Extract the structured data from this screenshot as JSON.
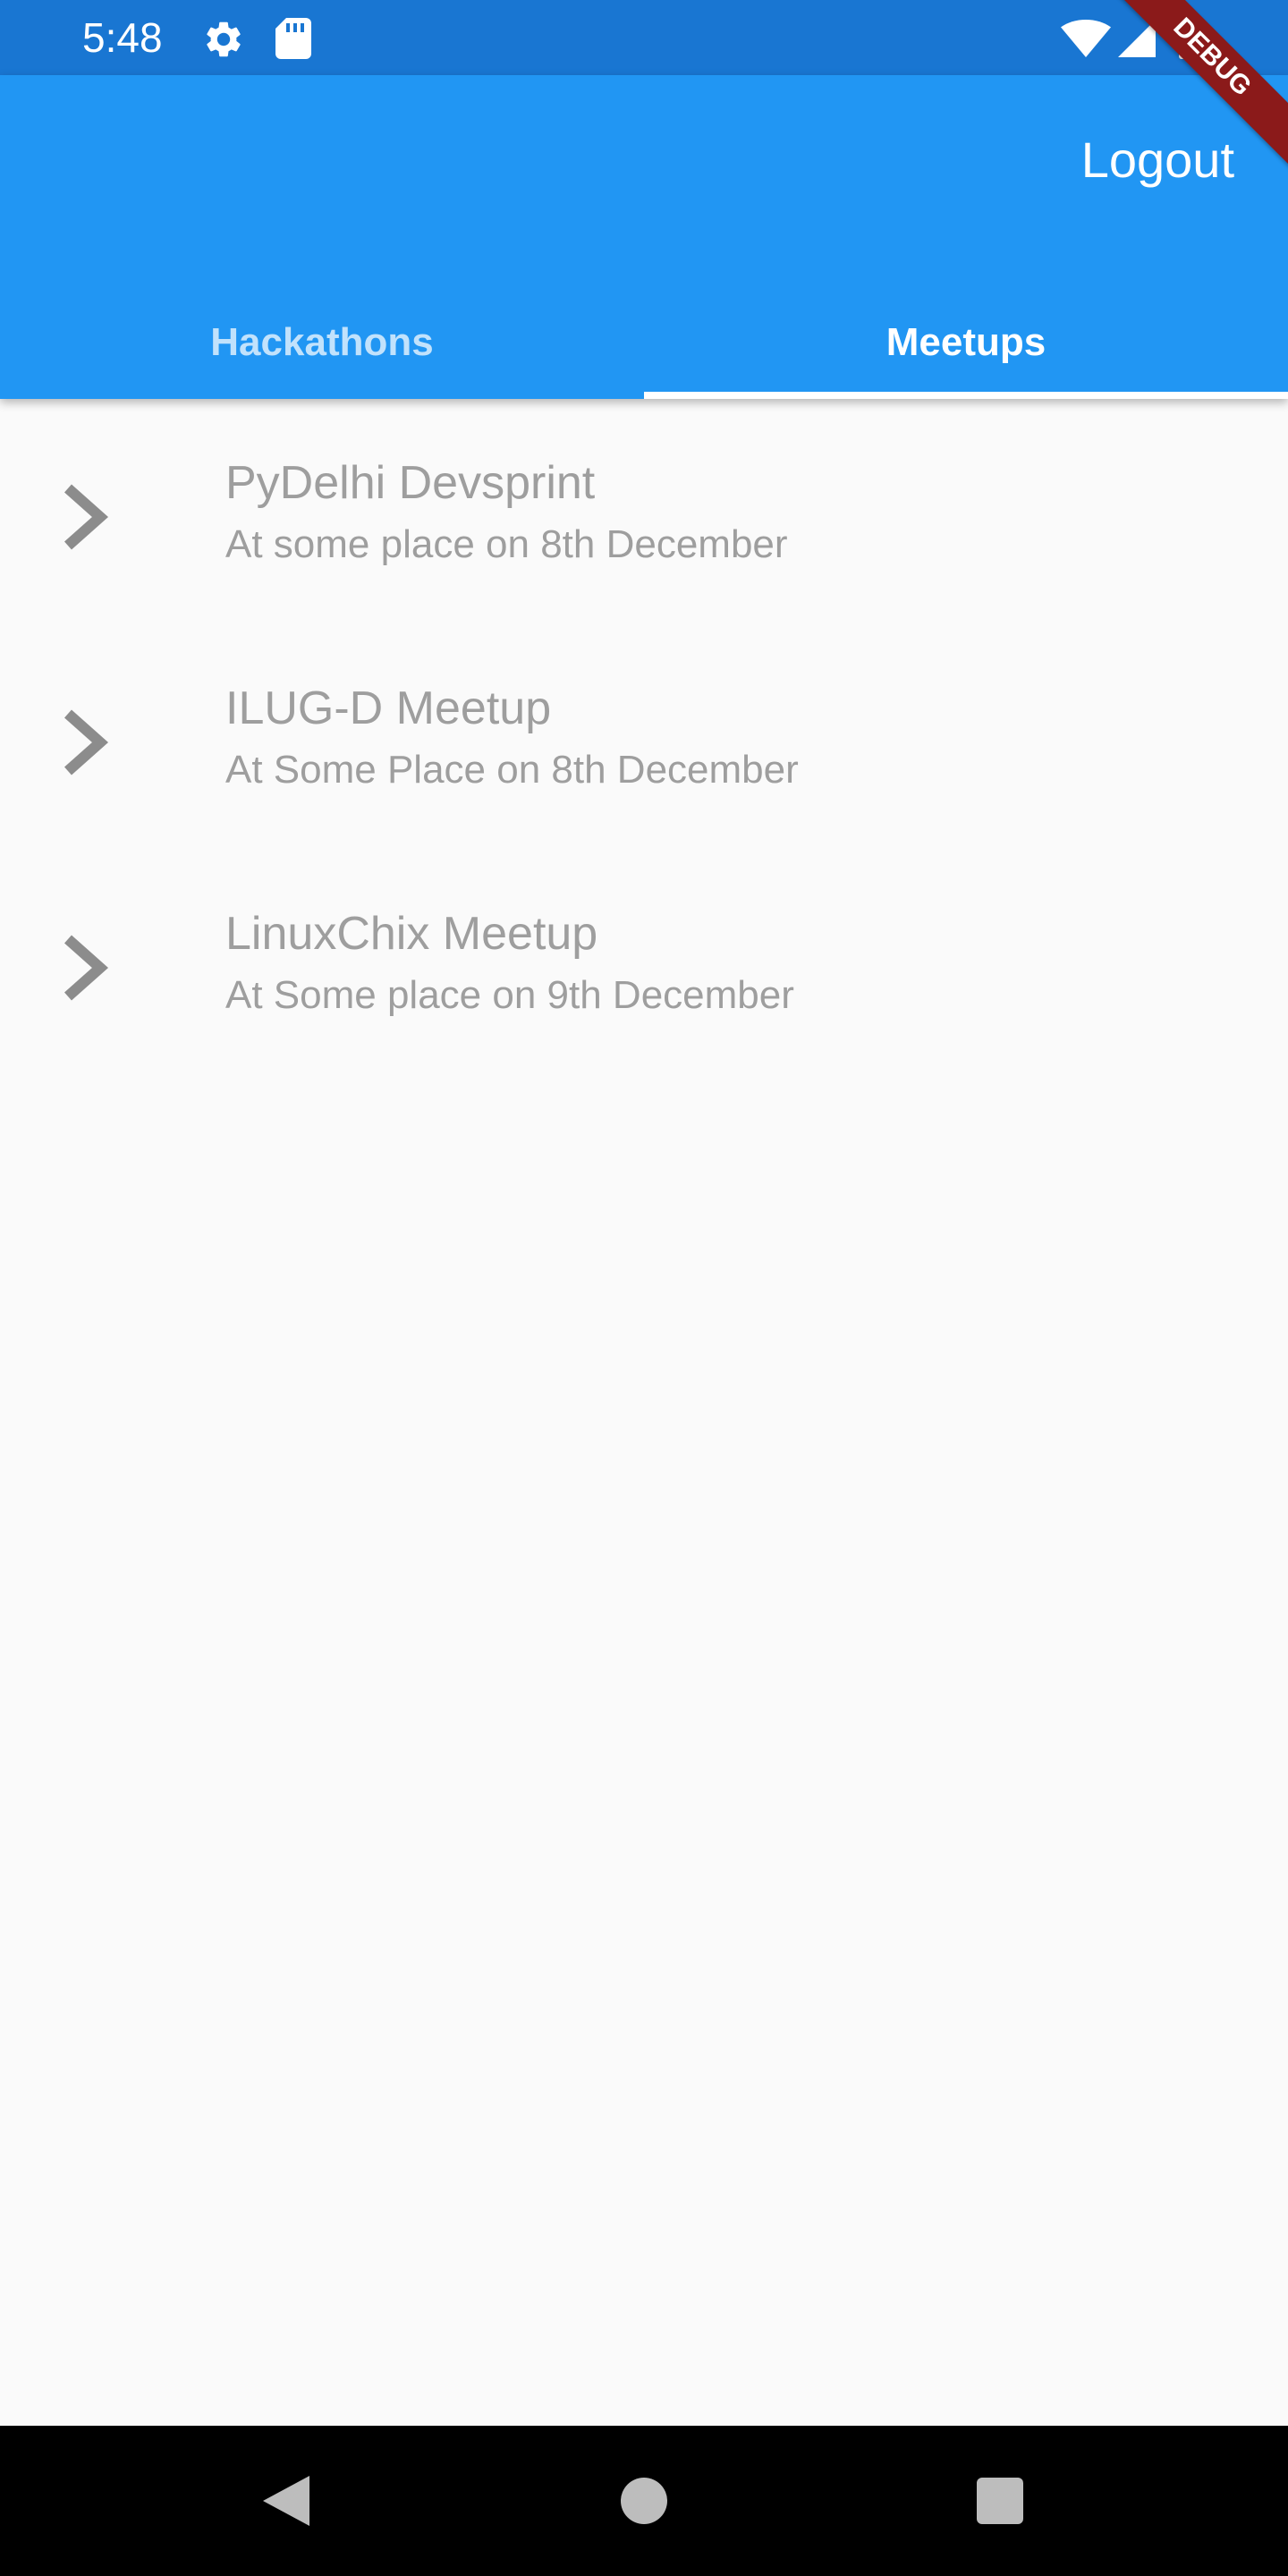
{
  "status_bar": {
    "time": "5:48",
    "icons": [
      "gear-icon",
      "sd-card-icon",
      "wifi-icon",
      "signal-icon",
      "battery-icon"
    ]
  },
  "app_bar": {
    "logout_label": "Logout",
    "color": "#2196f3",
    "status_color": "#1976d2"
  },
  "tabs": [
    {
      "label": "Hackathons",
      "active": false
    },
    {
      "label": "Meetups",
      "active": true
    }
  ],
  "debug_banner": "DEBUG",
  "meetups": [
    {
      "title": "PyDelhi Devsprint",
      "subtitle": "At some place on 8th December"
    },
    {
      "title": "ILUG-D Meetup",
      "subtitle": "At Some Place on 8th December"
    },
    {
      "title": "LinuxChix Meetup",
      "subtitle": "At Some place on 9th December"
    }
  ],
  "nav_bar": {
    "icons": [
      "back-icon",
      "home-icon",
      "recents-icon"
    ]
  }
}
